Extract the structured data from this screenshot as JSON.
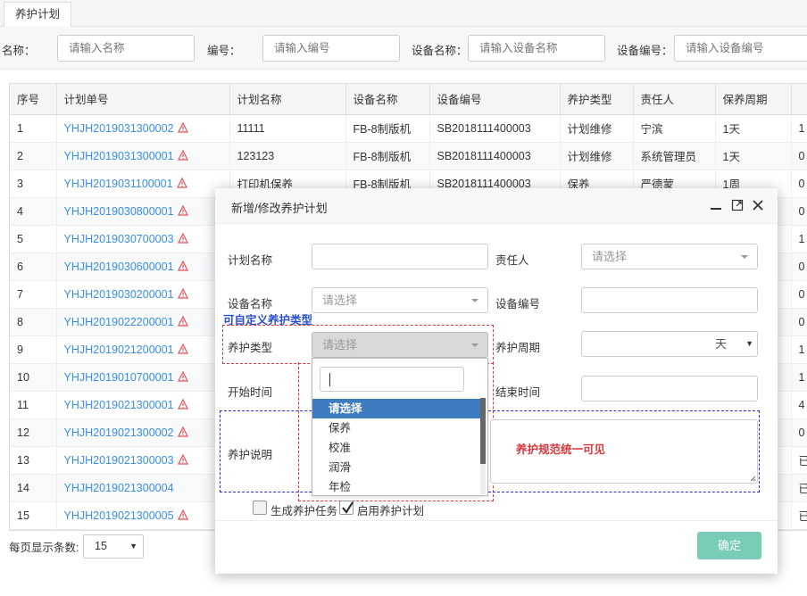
{
  "tab": "养护计划",
  "filters": [
    {
      "label": "名称：",
      "placeholder": "请输入名称"
    },
    {
      "label": "编号：",
      "placeholder": "请输入编号"
    },
    {
      "label": "设备名称：",
      "placeholder": "请输入设备名称"
    },
    {
      "label": "设备编号：",
      "placeholder": "请输入设备编号"
    }
  ],
  "table": {
    "headers": [
      "序号",
      "计划单号",
      "计划名称",
      "设备名称",
      "设备编号",
      "养护类型",
      "责任人",
      "保养周期",
      ""
    ],
    "rows": [
      [
        "1",
        "YHJH2019031300002",
        "11111",
        "FB-8制版机",
        "SB2018111400003",
        "计划维修",
        "宁滨",
        "1天",
        "1"
      ],
      [
        "2",
        "YHJH2019031300001",
        "123123",
        "FB-8制版机",
        "SB2018111400003",
        "计划维修",
        "系统管理员",
        "1天",
        "0"
      ],
      [
        "3",
        "YHJH2019031100001",
        "打印机保养",
        "FB-8制版机",
        "SB2018111400003",
        "保养",
        "严德蒙",
        "1周",
        "0"
      ],
      [
        "4",
        "YHJH2019030800001",
        "",
        "",
        "",
        "",
        "",
        "",
        "0"
      ],
      [
        "5",
        "YHJH2019030700003",
        "",
        "",
        "",
        "",
        "",
        "",
        "1"
      ],
      [
        "6",
        "YHJH2019030600001",
        "",
        "",
        "",
        "",
        "",
        "",
        "0"
      ],
      [
        "7",
        "YHJH2019030200001",
        "",
        "",
        "",
        "",
        "",
        "",
        "0"
      ],
      [
        "8",
        "YHJH2019022200001",
        "",
        "",
        "",
        "",
        "",
        "",
        "0"
      ],
      [
        "9",
        "YHJH2019021200001",
        "",
        "",
        "",
        "",
        "",
        "",
        "1"
      ],
      [
        "10",
        "YHJH2019010700001",
        "",
        "",
        "",
        "",
        "",
        "",
        "1"
      ],
      [
        "11",
        "YHJH2019021300001",
        "",
        "",
        "",
        "",
        "",
        "",
        "4"
      ],
      [
        "12",
        "YHJH2019021300002",
        "",
        "",
        "",
        "",
        "",
        "",
        "0"
      ],
      [
        "13",
        "YHJH2019021300003",
        "",
        "",
        "",
        "",
        "",
        "",
        "已"
      ],
      [
        "14",
        "YHJH2019021300004",
        "",
        "",
        "",
        "",
        "",
        "",
        "已"
      ],
      [
        "15",
        "YHJH2019021300005",
        "",
        "",
        "",
        "",
        "",
        "",
        "已"
      ]
    ],
    "warn_rows": [
      1,
      2,
      3,
      4,
      5,
      6,
      7,
      8,
      9,
      10,
      11,
      12,
      13,
      15
    ]
  },
  "pager": {
    "label": "每页显示条数:",
    "value": "15"
  },
  "modal": {
    "title": "新增/修改养护计划",
    "plan_name_label": "计划名称",
    "owner_label": "责任人",
    "owner_placeholder": "请选择",
    "device_name_label": "设备名称",
    "device_name_placeholder": "请选择",
    "device_no_label": "设备编号",
    "type_label": "养护类型",
    "type_placeholder": "请选择",
    "cycle_label": "养护周期",
    "cycle_unit": "天",
    "start_label": "开始时间",
    "end_label": "结束时间",
    "desc_label": "养护说明",
    "dropdown_options": [
      "请选择",
      "保养",
      "校准",
      "润滑",
      "年检"
    ],
    "chk_generate": "生成养护任务",
    "chk_enable": "启用养护计划",
    "ok_button": "确定"
  },
  "annotations": {
    "custom_type": "可自定义养护类型",
    "spec_visible": "养护规范统一可见"
  },
  "colors": {
    "link": "#3a8ee6",
    "selected": "#3e7cbf",
    "ok": "#79cdb7",
    "red_note": "#d9363e",
    "blue_note": "#2a2fbf"
  }
}
